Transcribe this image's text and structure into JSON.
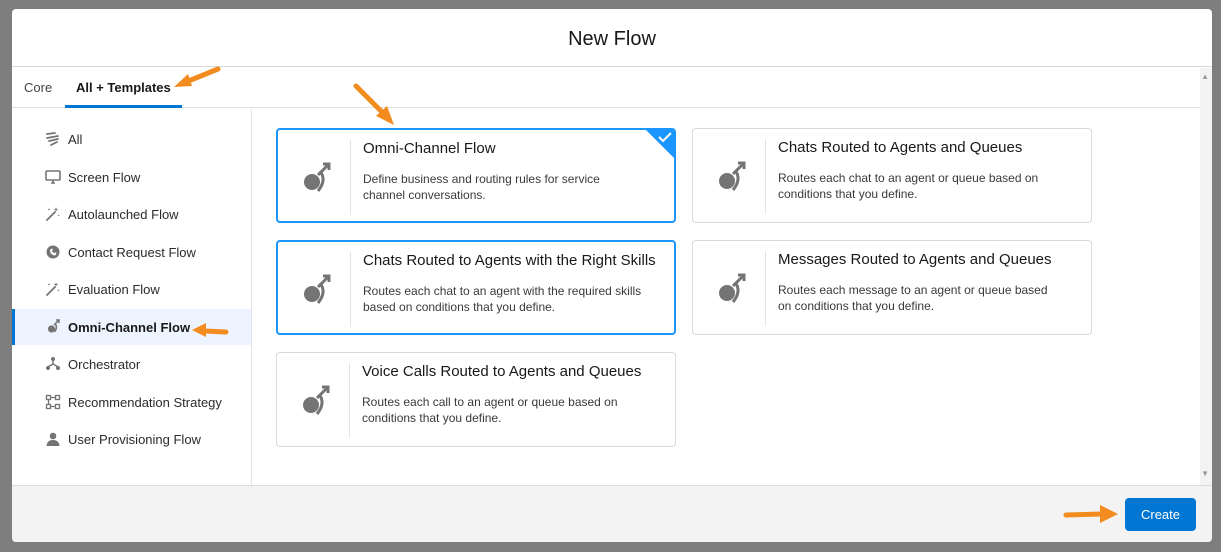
{
  "modal": {
    "title": "New Flow"
  },
  "tabs": [
    {
      "label": "Core"
    },
    {
      "label": "All + Templates"
    }
  ],
  "sidebar": {
    "items": [
      {
        "label": "All",
        "icon": "list-icon"
      },
      {
        "label": "Screen Flow",
        "icon": "monitor-icon"
      },
      {
        "label": "Autolaunched Flow",
        "icon": "magic-wand-icon"
      },
      {
        "label": "Contact Request Flow",
        "icon": "contact-request-icon"
      },
      {
        "label": "Evaluation Flow",
        "icon": "magic-wand-icon"
      },
      {
        "label": "Omni-Channel Flow",
        "icon": "omni-channel-icon",
        "active": true
      },
      {
        "label": "Orchestrator",
        "icon": "orchestrator-icon"
      },
      {
        "label": "Recommendation Strategy",
        "icon": "strategy-icon"
      },
      {
        "label": "User Provisioning Flow",
        "icon": "user-icon"
      }
    ]
  },
  "cards": [
    {
      "title": "Omni-Channel Flow",
      "description": "Define business and routing rules for service channel conversations.",
      "selected": true
    },
    {
      "title": "Chats Routed to Agents and Queues",
      "description": "Routes each chat to an agent or queue based on conditions that you define."
    },
    {
      "title": "Chats Routed to Agents with the Right Skills",
      "description": "Routes each chat to an agent with the required skills based on conditions that you define."
    },
    {
      "title": "Messages Routed to Agents and Queues",
      "description": "Routes each message to an agent or queue based on conditions that you define."
    },
    {
      "title": "Voice Calls Routed to Agents and Queues",
      "description": "Routes each call to an agent or queue based on conditions that you define."
    }
  ],
  "footer": {
    "create_label": "Create"
  },
  "colors": {
    "accent": "#0176d3",
    "selected_border": "#1b96ff",
    "annotation_arrow": "#f28c1e"
  }
}
